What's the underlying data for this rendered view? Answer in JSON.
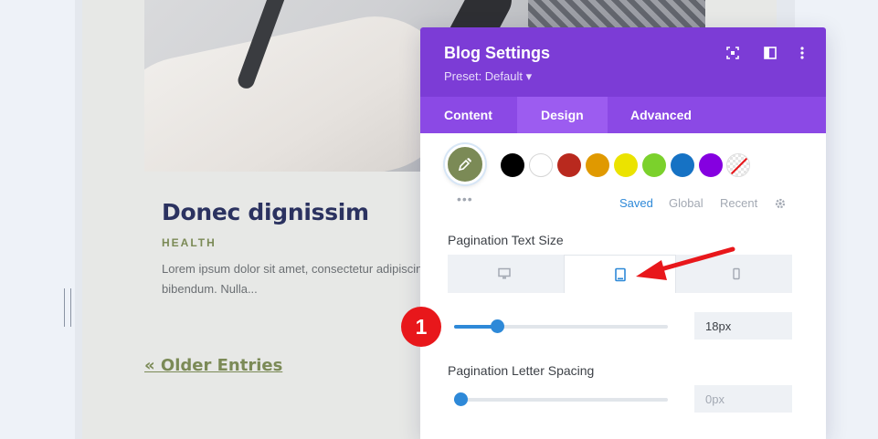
{
  "post": {
    "title": "Donec dignissim",
    "category": "HEALTH",
    "excerpt_line1": "Lorem ipsum dolor sit amet, consectetur adipiscing",
    "excerpt_line2": "bibendum. Nulla...",
    "older_entries": "« Older Entries"
  },
  "panel": {
    "title": "Blog Settings",
    "preset": "Preset: Default ▾",
    "tabs": [
      {
        "label": "Content"
      },
      {
        "label": "Design",
        "active": true
      },
      {
        "label": "Advanced"
      }
    ],
    "colors": {
      "selected": "#7b8a56",
      "swatches": [
        "#000000",
        "#ffffff",
        "#b9291e",
        "#e09900",
        "#ebe300",
        "#7bd12c",
        "#1672c4",
        "#8500e0"
      ]
    },
    "color_tabs": {
      "saved": "Saved",
      "global": "Global",
      "recent": "Recent"
    },
    "pagination_text_size": {
      "label": "Pagination Text Size",
      "devices": [
        "desktop-icon",
        "tablet-icon",
        "phone-icon"
      ],
      "active_device": "tablet",
      "value": "18px",
      "slider_fraction": 0.2
    },
    "pagination_letter_spacing": {
      "label": "Pagination Letter Spacing",
      "value": "0px",
      "slider_fraction": 0.03
    }
  },
  "annotation": {
    "step": "1",
    "accent": "#e8171b"
  }
}
